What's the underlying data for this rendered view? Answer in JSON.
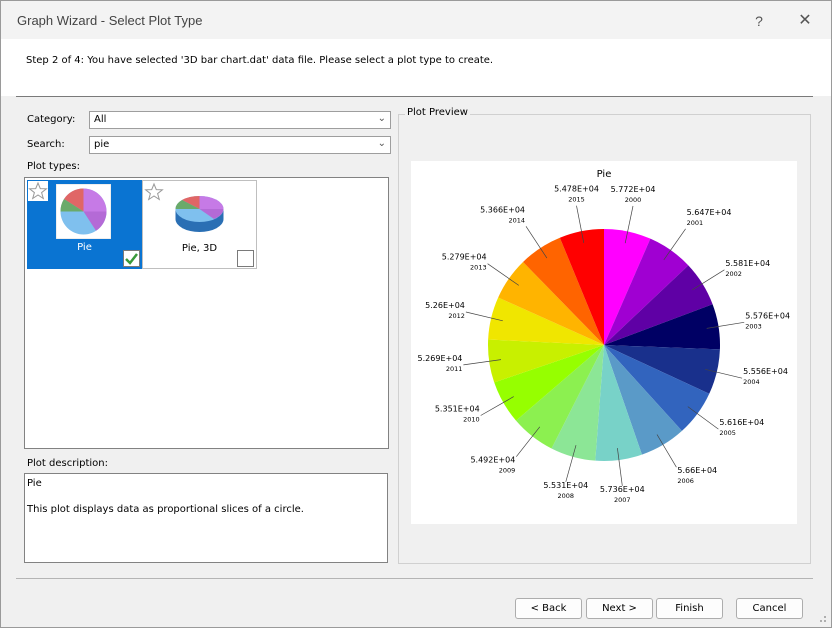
{
  "window": {
    "title": "Graph Wizard - Select Plot Type",
    "help_label": "?",
    "close_label": "✕"
  },
  "step_text": "Step 2 of 4:  You have selected '3D bar chart.dat' data file. Please select a plot type to create.",
  "category": {
    "label": "Category:",
    "value": "All"
  },
  "search": {
    "label": "Search:",
    "value": "pie"
  },
  "plot_types": {
    "label": "Plot types:",
    "items": [
      {
        "label": "Pie",
        "selected": true,
        "checked": true,
        "icon": "pie-chart-icon"
      },
      {
        "label": "Pie, 3D",
        "selected": false,
        "checked": false,
        "icon": "pie-3d-chart-icon"
      }
    ]
  },
  "description": {
    "label": "Plot description:",
    "line1": "Pie",
    "line2": "This plot displays data as proportional slices of a circle."
  },
  "preview": {
    "label": "Plot Preview"
  },
  "buttons": {
    "back": "< Back",
    "next": "Next >",
    "finish": "Finish",
    "cancel": "Cancel"
  },
  "colors": {
    "selection": "#0a74d2"
  },
  "chart_data": {
    "type": "pie",
    "title": "Pie",
    "categories": [
      "2000",
      "2001",
      "2002",
      "2003",
      "2004",
      "2005",
      "2006",
      "2007",
      "2008",
      "2009",
      "2010",
      "2011",
      "2012",
      "2013",
      "2014",
      "2015"
    ],
    "value_labels": [
      "5.772E+04",
      "5.647E+04",
      "5.581E+04",
      "5.576E+04",
      "5.556E+04",
      "5.616E+04",
      "5.66E+04",
      "5.736E+04",
      "5.531E+04",
      "5.492E+04",
      "5.351E+04",
      "5.269E+04",
      "5.26E+04",
      "5.279E+04",
      "5.366E+04",
      "5.478E+04"
    ],
    "values": [
      57720,
      56470,
      55810,
      55760,
      55560,
      56160,
      56600,
      57360,
      55310,
      54920,
      53510,
      52690,
      52600,
      52790,
      53660,
      54780
    ],
    "colors": [
      "#ff00ff",
      "#a000d2",
      "#5f00a5",
      "#000064",
      "#19308c",
      "#3264be",
      "#5a9ac8",
      "#78d2c8",
      "#8ce696",
      "#8cf050",
      "#96ff00",
      "#c8f000",
      "#f0e600",
      "#ffb400",
      "#ff6400",
      "#ff0000"
    ]
  }
}
